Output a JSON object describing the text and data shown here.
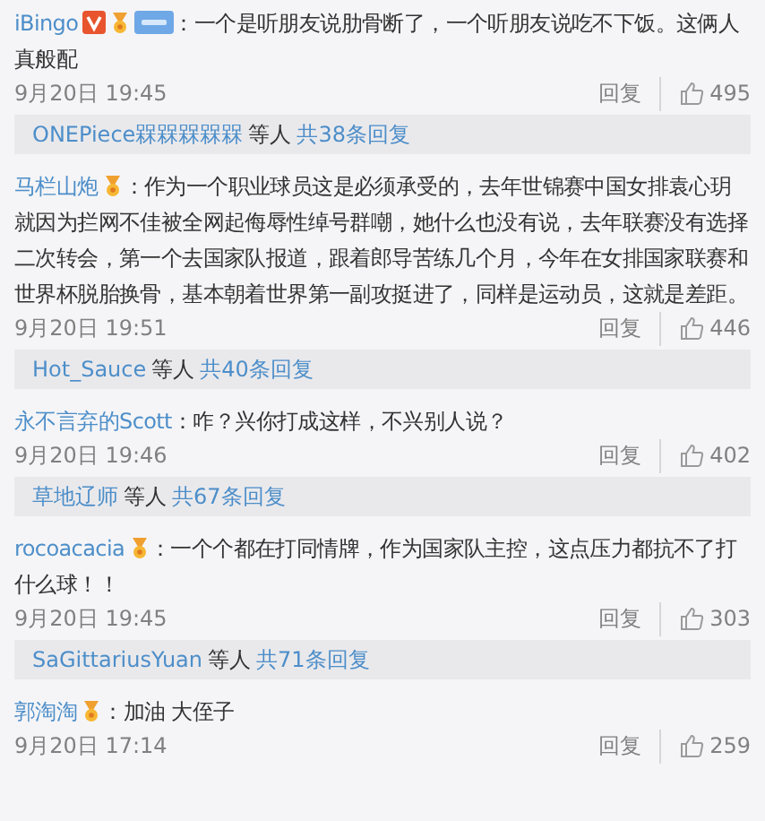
{
  "comments": [
    {
      "user": "iBingo",
      "badges": [
        {
          "kind": "verified"
        },
        {
          "kind": "medal"
        },
        {
          "kind": "level"
        }
      ],
      "text": "：一个是听朋友说肋骨断了，一个听朋友说吃不下饭。这俩人真般配",
      "time": "9月20日 19:45",
      "reply": "回复",
      "likes": "495",
      "thread": {
        "names": "ONEPiece槑槑槑槑槑",
        "middle": "等人",
        "count": "共38条回复"
      }
    },
    {
      "user": "马栏山炮",
      "badges": [
        {
          "kind": "medal"
        }
      ],
      "text": "：作为一个职业球员这是必须承受的，去年世锦赛中国女排袁心玥就因为拦网不佳被全网起侮辱性绰号群嘲，她什么也没有说，去年联赛没有选择二次转会，第一个去国家队报道，跟着郎导苦练几个月，今年在女排国家联赛和世界杯脱胎换骨，基本朝着世界第一副攻挺进了，同样是运动员，这就是差距。",
      "time": "9月20日 19:51",
      "reply": "回复",
      "likes": "446",
      "thread": {
        "names": "Hot_Sauce",
        "middle": "等人",
        "count": "共40条回复"
      }
    },
    {
      "user": "永不言弃的Scott",
      "text": "：咋？兴你打成这样，不兴别人说？",
      "time": "9月20日 19:46",
      "reply": "回复",
      "likes": "402",
      "thread": {
        "names": "草地辽师",
        "middle": "等人",
        "count": "共67条回复"
      }
    },
    {
      "user": "rocoacacia",
      "badges": [
        {
          "kind": "medal"
        }
      ],
      "text": "：一个个都在打同情牌，作为国家队主控，这点压力都抗不了打什么球！！",
      "time": "9月20日 19:45",
      "reply": "回复",
      "likes": "303",
      "thread": {
        "names": "SaGittariusYuan",
        "middle": "等人",
        "count": "共71条回复"
      }
    },
    {
      "user": "郭淘淘",
      "badges": [
        {
          "kind": "medal"
        }
      ],
      "text": "：加油  大侄子",
      "time": "9月20日 17:14",
      "reply": "回复",
      "likes": "259"
    }
  ]
}
